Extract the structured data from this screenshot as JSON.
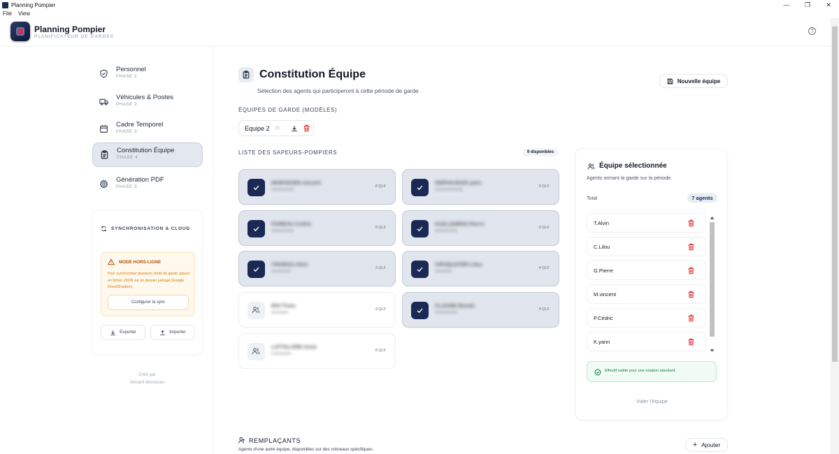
{
  "window": {
    "title": "Planning Pompier",
    "menu": [
      "File",
      "View"
    ],
    "controls": [
      "—",
      "❐",
      "✕"
    ]
  },
  "header": {
    "app_title": "Planning Pompier",
    "app_subtitle": "PLANIFICATEUR DE GARDES"
  },
  "sidebar": {
    "items": [
      {
        "label": "Personnel",
        "phase": "PHASE 1",
        "icon": "shield-icon"
      },
      {
        "label": "Véhicules & Postes",
        "phase": "PHASE 2",
        "icon": "truck-icon"
      },
      {
        "label": "Cadre Temporel",
        "phase": "PHASE 3",
        "icon": "calendar-icon"
      },
      {
        "label": "Constitution Équipe",
        "phase": "PHASE 4",
        "icon": "clipboard-icon",
        "active": true
      },
      {
        "label": "Génération PDF",
        "phase": "PHASE 5",
        "icon": "gear-icon"
      }
    ],
    "sync": {
      "title": "SYNCHRONISATION & CLOUD",
      "offline_title": "MODE HORS-LIGNE",
      "offline_text": "Pour synchroniser plusieurs chefs de garde, placez un fichier JSON sur un dossier partagé (Google Drive/Dropbox).",
      "config_label": "Configurer la sync",
      "export_label": "Exporter",
      "import_label": "Importer"
    },
    "credit_line1": "Créé par",
    "credit_line2": "Vincent Morvezen"
  },
  "main": {
    "title": "Constitution Équipe",
    "subtitle": "Sélection des agents qui participeront à cette période de garde",
    "new_team_label": "Nouvelle équipe",
    "models_label": "ÉQUIPES DE GARDE (MODÈLES)",
    "model": {
      "name": "Equipe 2",
      "count": "(7)"
    },
    "list_label": "LISTE DES SAPEURS-POMPIERS",
    "available": "9 disponibles",
    "agents": [
      {
        "name": "MORVEZEN vincent",
        "detail": "SSSSSSSS",
        "qlf": "8 QLF",
        "selected": true
      },
      {
        "name": "KERVAUDAN yann",
        "detail": "SSSSSSSSSS",
        "qlf": "9 QLF",
        "selected": true
      },
      {
        "name": "POREAU Cedric",
        "detail": "SSSSSSSS",
        "qlf": "9 QLF",
        "selected": true
      },
      {
        "name": "GUILLEMINO Pierre",
        "detail": "SSSSSSSS",
        "qlf": "8 QLF",
        "selected": true
      },
      {
        "name": "THOMAS Alvin",
        "detail": "SSSSSSS",
        "qlf": "3 QLF",
        "selected": true
      },
      {
        "name": "CROQUATER Lilou",
        "detail": "SSSSSS",
        "qlf": "4 QLF",
        "selected": true
      },
      {
        "name": "BOI Tisen",
        "detail": "SSSSSS",
        "qlf": "3 QLF",
        "selected": false
      },
      {
        "name": "CLAUDE Benoit",
        "detail": "SSSSSSSS",
        "qlf": "9 QLF",
        "selected": true
      },
      {
        "name": "LATTALORE Anne",
        "detail": "SSSSSSS",
        "qlf": "8 QLF",
        "selected": false
      }
    ]
  },
  "team": {
    "title": "Équipe sélectionnée",
    "subtitle": "Agents armant la garde sur la période.",
    "total_label": "Total",
    "total_value": "7 agents",
    "members": [
      "T.Alvin",
      "C.Lilou",
      "G.Pierre",
      "M.vincent",
      "P.Cédric",
      "K.yann"
    ],
    "valid_text": "Effectif validé pour une rotation standard.",
    "clear_label": "Vider l'équipe"
  },
  "replacements": {
    "title": "REMPLAÇANTS",
    "subtitle": "Agents d'une autre équipe, disponibles sur des créneaux spécifiques.",
    "add_label": "Ajouter"
  },
  "colors": {
    "primary": "#1b2a55",
    "danger": "#dc2626",
    "warning": "#b45309",
    "success": "#15803d"
  }
}
